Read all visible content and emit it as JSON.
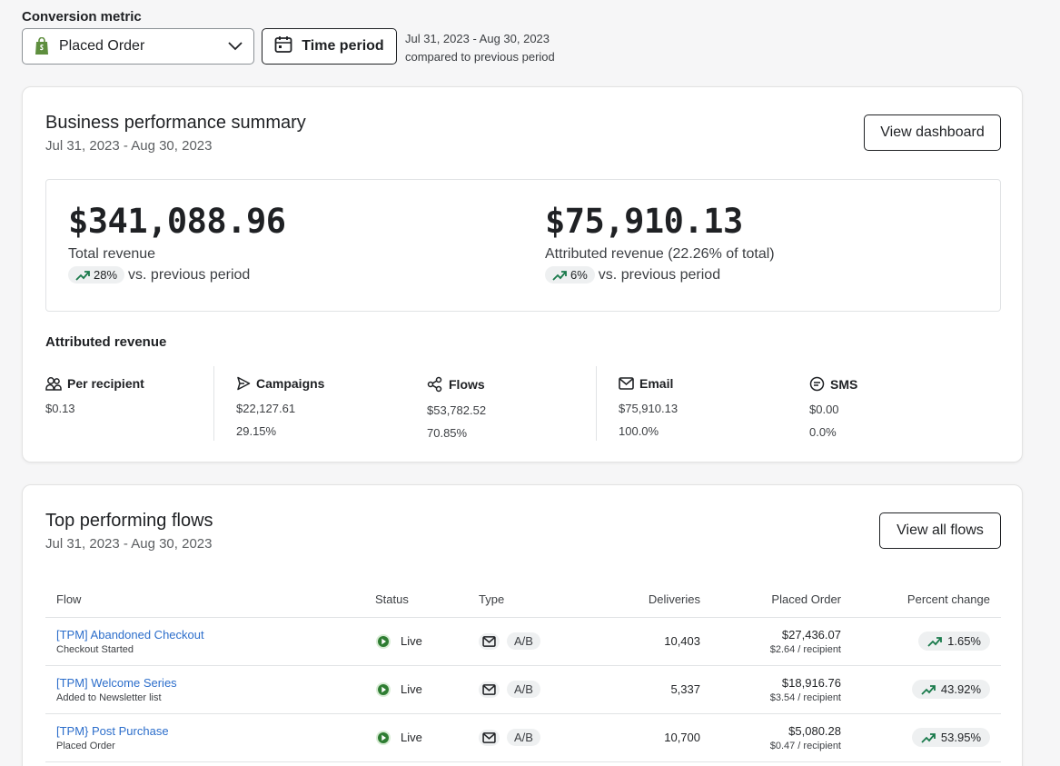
{
  "filters": {
    "metric_label": "Conversion metric",
    "metric_value": "Placed Order",
    "time_button": "Time period",
    "range_line1": "Jul 31, 2023 - Aug 30, 2023",
    "range_line2": "compared to previous period"
  },
  "summary": {
    "title": "Business performance summary",
    "date": "Jul 31, 2023 - Aug 30, 2023",
    "button": "View dashboard",
    "total": {
      "value": "$341,088.96",
      "label": "Total revenue",
      "change": "28%",
      "vs": "vs. previous period"
    },
    "attributed": {
      "value": "$75,910.13",
      "label": "Attributed revenue (22.26% of total)",
      "change": "6%",
      "vs": "vs. previous period"
    },
    "attr_title": "Attributed revenue",
    "breakdown": [
      {
        "icon": "users-icon",
        "label": "Per recipient",
        "v1": "$0.13",
        "v2": ""
      },
      {
        "icon": "send-icon",
        "label": "Campaigns",
        "v1": "$22,127.61",
        "v2": "29.15%"
      },
      {
        "icon": "share-nodes-icon",
        "label": "Flows",
        "v1": "$53,782.52",
        "v2": "70.85%"
      },
      {
        "icon": "mail-icon",
        "label": "Email",
        "v1": "$75,910.13",
        "v2": "100.0%"
      },
      {
        "icon": "sms-icon",
        "label": "SMS",
        "v1": "$0.00",
        "v2": "0.0%"
      }
    ]
  },
  "flows": {
    "title": "Top performing flows",
    "date": "Jul 31, 2023 - Aug 30, 2023",
    "button": "View all flows",
    "columns": [
      "Flow",
      "Status",
      "Type",
      "Deliveries",
      "Placed Order",
      "Percent change"
    ],
    "rows": [
      {
        "name": "[TPM] Abandoned Checkout",
        "trigger": "Checkout Started",
        "status": "Live",
        "type": "A/B",
        "deliveries": "10,403",
        "order": "$27,436.07",
        "per": "$2.64 / recipient",
        "change": "1.65%"
      },
      {
        "name": "[TPM] Welcome Series",
        "trigger": "Added to Newsletter list",
        "status": "Live",
        "type": "A/B",
        "deliveries": "5,337",
        "order": "$18,916.76",
        "per": "$3.54 / recipient",
        "change": "43.92%"
      },
      {
        "name": "[TPM} Post Purchase",
        "trigger": "Placed Order",
        "status": "Live",
        "type": "A/B",
        "deliveries": "10,700",
        "order": "$5,080.28",
        "per": "$0.47 / recipient",
        "change": "53.95%"
      }
    ]
  },
  "colors": {
    "accent_link": "#2c6ecb",
    "live_green": "#2e7d32",
    "trend_green": "#1a7a4c",
    "shopify_green": "#5e8e3e"
  }
}
